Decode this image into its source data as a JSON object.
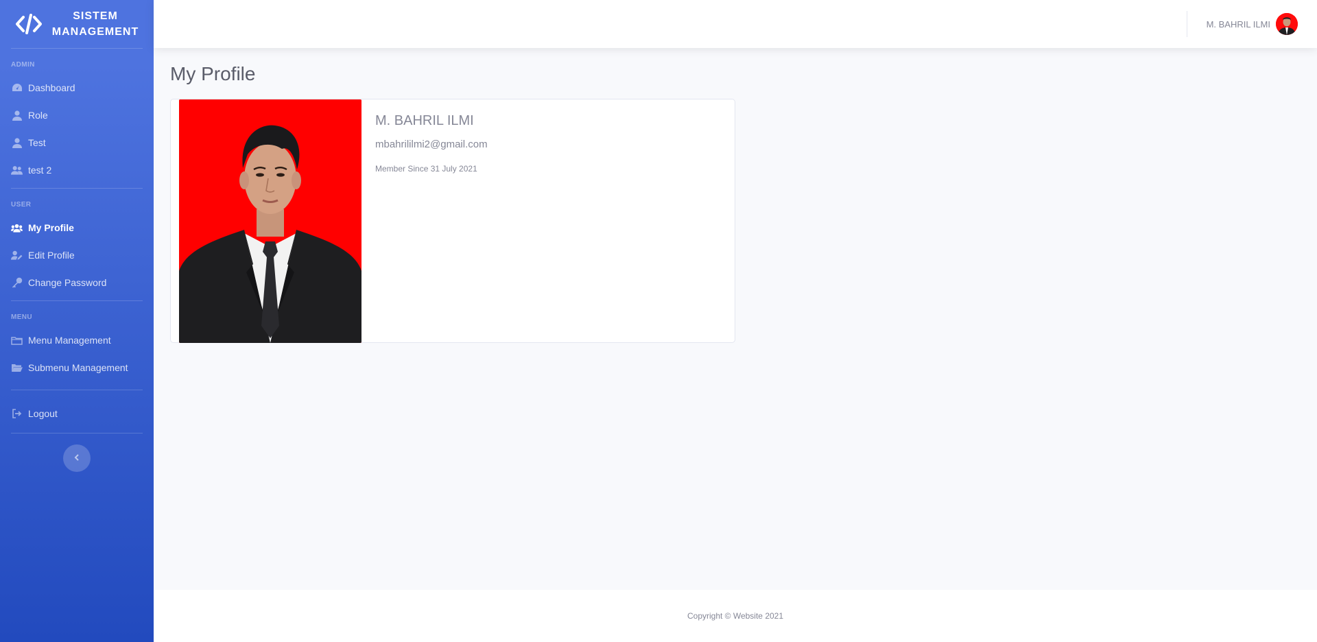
{
  "brand": {
    "line1": "SISTEM",
    "line2": "MANAGEMENT",
    "logo_icon": "code-logo-icon"
  },
  "sidebar": {
    "sections": [
      {
        "heading": "ADMIN",
        "items": [
          {
            "label": "Dashboard",
            "icon": "tachometer-icon"
          },
          {
            "label": "Role",
            "icon": "user-icon"
          },
          {
            "label": "Test",
            "icon": "user-icon"
          },
          {
            "label": "test 2",
            "icon": "user-friends-icon"
          }
        ]
      },
      {
        "heading": "USER",
        "items": [
          {
            "label": "My Profile",
            "icon": "users-icon",
            "active": true
          },
          {
            "label": "Edit Profile",
            "icon": "user-edit-icon"
          },
          {
            "label": "Change Password",
            "icon": "key-icon"
          }
        ]
      },
      {
        "heading": "MENU",
        "items": [
          {
            "label": "Menu Management",
            "icon": "folder-icon"
          },
          {
            "label": "Submenu Management",
            "icon": "folder-open-icon"
          }
        ]
      }
    ],
    "logout_label": "Logout",
    "toggle_icon": "chevron-left-icon"
  },
  "topbar": {
    "user_name": "M. BAHRIL ILMI"
  },
  "page": {
    "title": "My Profile"
  },
  "profile": {
    "name": "M. BAHRIL ILMI",
    "email": "mbahrililmi2@gmail.com",
    "member_since": "Member Since 31 July 2021"
  },
  "footer": {
    "text": "Copyright © Website 2021"
  },
  "colors": {
    "sidebar_top": "#4e73df",
    "sidebar_bottom": "#224abe",
    "photo_bg": "#ff0000",
    "text_muted": "#858796"
  }
}
